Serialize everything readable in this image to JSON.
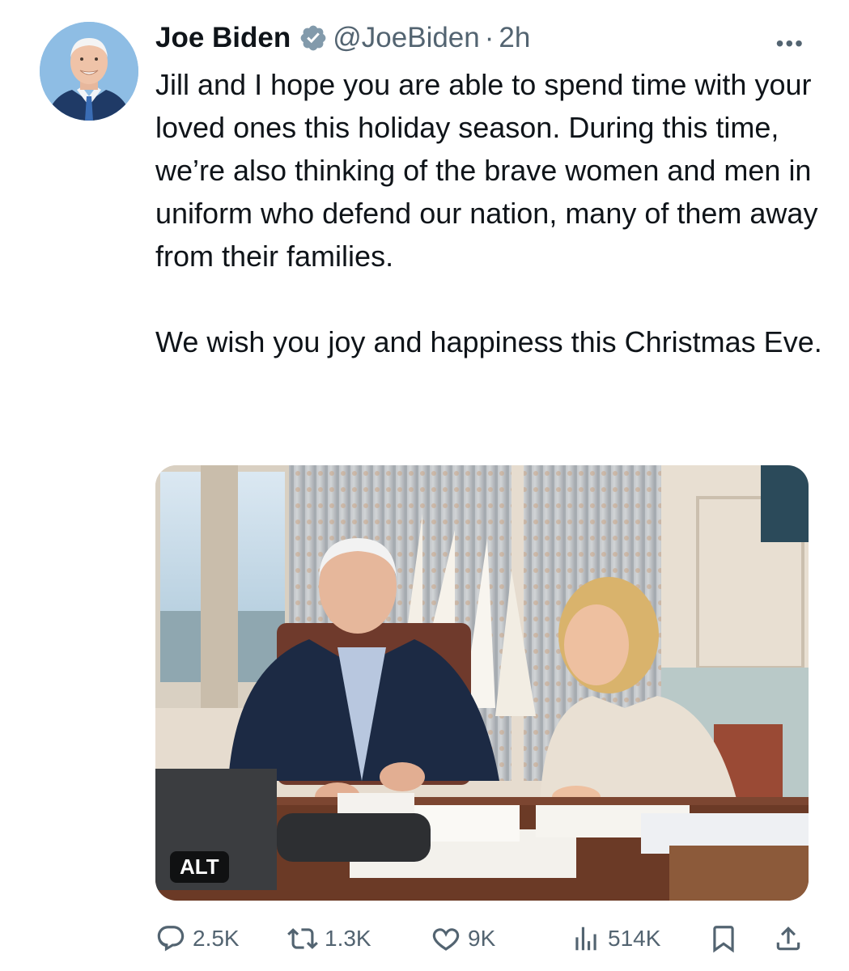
{
  "author": {
    "name": "Joe Biden",
    "handle": "@JoeBiden",
    "separator": "·",
    "time": "2h",
    "verified": true
  },
  "more_icon": "more-horizontal-icon",
  "text": {
    "paragraph1": "Jill and I hope you are able to spend time with your loved ones this holiday season. During this time, we’re also thinking of the brave women and men in uniform who defend our nation, many of them away from their families.",
    "paragraph2": "We wish you joy and happiness this Christmas Eve."
  },
  "media": {
    "alt_badge": "ALT"
  },
  "actions": {
    "replies": "2.5K",
    "reposts": "1.3K",
    "likes": "9K",
    "views": "514K"
  },
  "colors": {
    "text": "#0f1419",
    "secondary": "#536471",
    "verified_badge": "#829aab"
  }
}
